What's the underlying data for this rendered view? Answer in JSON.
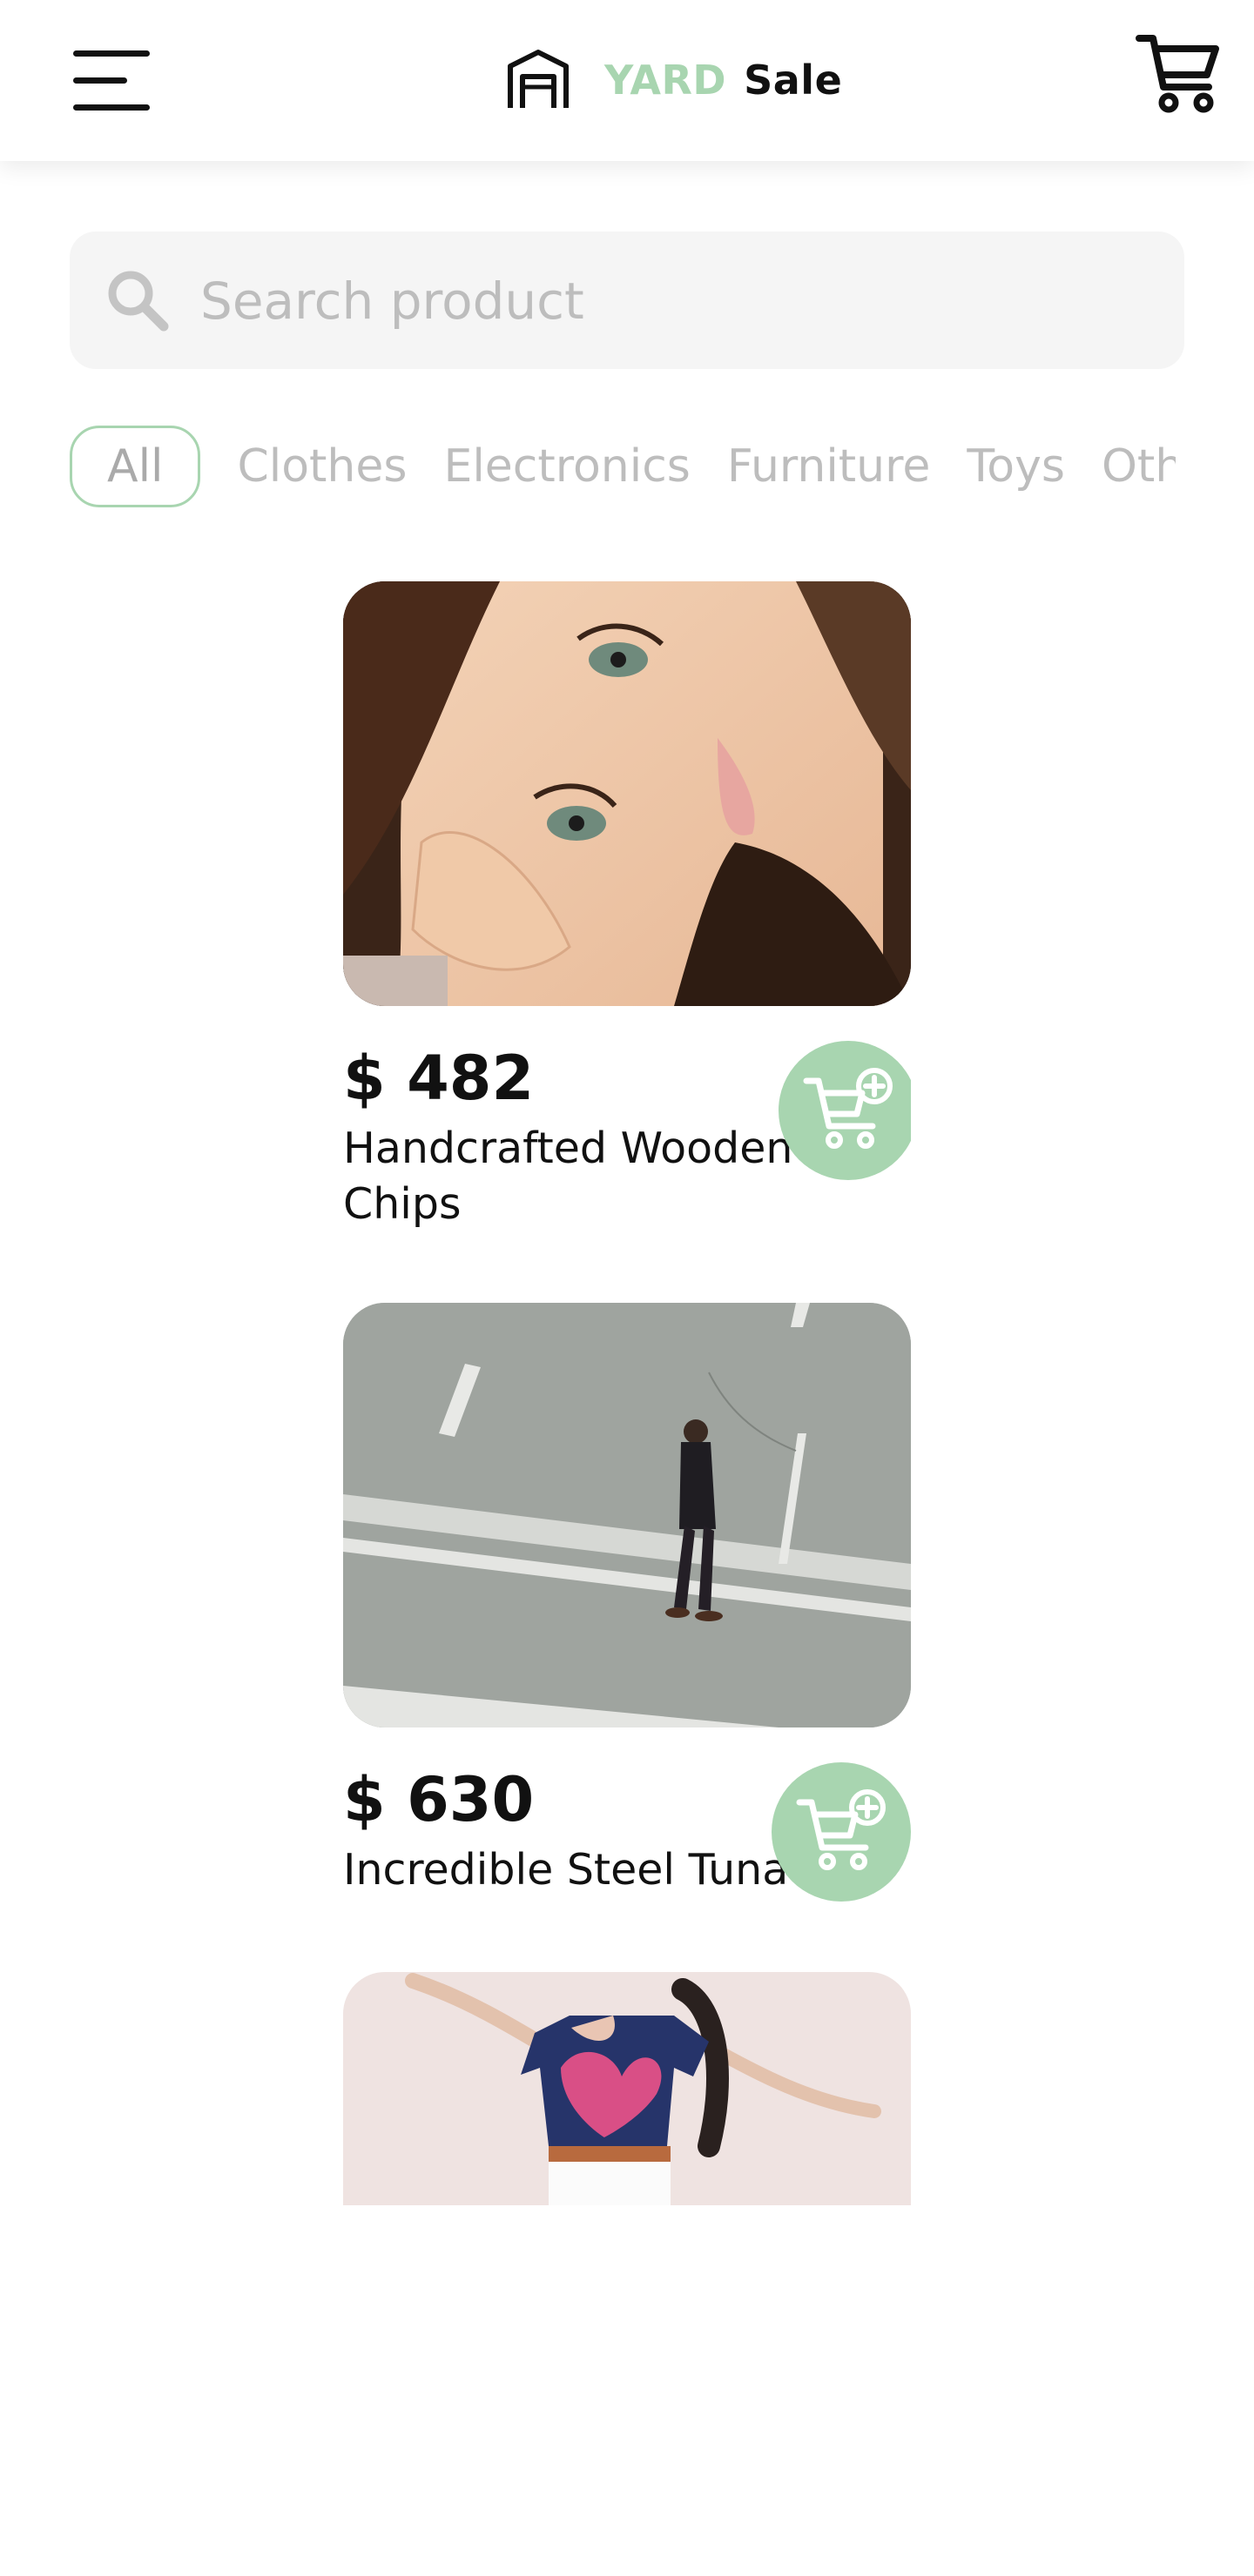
{
  "header": {
    "brand_yard": "YARD",
    "brand_sale": "Sale",
    "menu_icon": "hamburger-menu-icon",
    "logo_icon": "garage-icon",
    "cart_icon": "shopping-cart-icon"
  },
  "search": {
    "placeholder": "Search product",
    "value": "",
    "icon": "search-icon"
  },
  "categories": [
    {
      "label": "All",
      "active": true
    },
    {
      "label": "Clothes"
    },
    {
      "label": "Electronics"
    },
    {
      "label": "Furniture"
    },
    {
      "label": "Toys"
    },
    {
      "label": "Others"
    }
  ],
  "products": [
    {
      "price": "$ 482",
      "name": "Handcrafted Wooden Chips",
      "image": "portrait-woman-photo",
      "add_icon": "add-to-cart-icon"
    },
    {
      "price": "$ 630",
      "name": "Incredible Steel Tuna",
      "image": "man-walking-street-photo",
      "add_icon": "add-to-cart-icon"
    },
    {
      "price": "",
      "name": "",
      "image": "dancing-woman-photo"
    }
  ],
  "colors": {
    "accent": "#a8d5b0",
    "search_bg": "#f5f5f5",
    "muted_text": "#bdbdbd",
    "text": "#111111"
  }
}
